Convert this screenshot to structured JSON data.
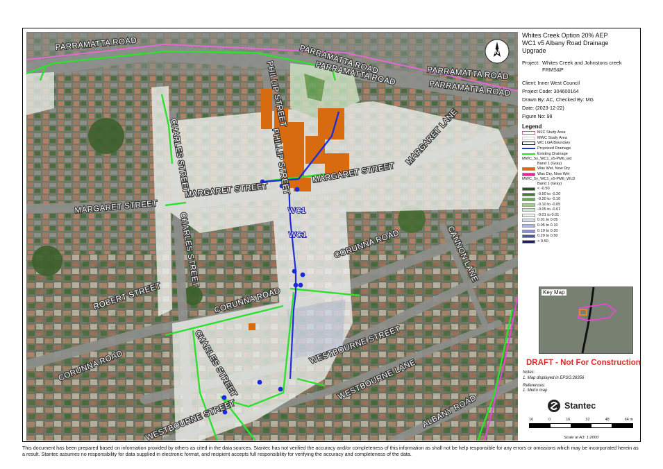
{
  "title": {
    "line1": "Whites Creek Option 20% AEP",
    "line2": "WC1 v5 Albany Road Drainage",
    "line3": "Upgrade"
  },
  "project": {
    "key": "Project:",
    "value": "Whites Creek and Johnstons creek FRMS&P"
  },
  "meta": {
    "client": "Client:  Inner West Council",
    "code": "Project Code:  304600164",
    "drawn": "Drawn By:  AC, Checked By: MG",
    "date": "Date:  (2023-12-22)",
    "figure": "Figure No:  98"
  },
  "north": "N",
  "legend": {
    "title": "Legend",
    "items": [
      {
        "label": "MJC Study Area",
        "kind": "box",
        "color": "#e04bd0"
      },
      {
        "label": "MWC Study Area",
        "kind": "box",
        "color": "#f2b2e8"
      },
      {
        "label": "WC LGA Boundary",
        "kind": "box",
        "color": "#111111"
      },
      {
        "label": "Proposed Drainage",
        "kind": "line",
        "color": "#1d2fd6"
      },
      {
        "label": "Existing Drainage",
        "kind": "line",
        "color": "#2ee02e"
      }
    ],
    "group1": {
      "name": "MWC_5y_WC1_v5-PM6_wd",
      "band": "Band 1 (Gray)"
    },
    "wetdry": [
      {
        "label": "Was Wet, Now Dry",
        "color": "#d86a10"
      },
      {
        "label": "Was Dry, Now Wet",
        "color": "#e0249a"
      }
    ],
    "group2": {
      "name": "MWC_5y_WC1_v5-PM6_WLD",
      "band": "Band 1 (Gray)"
    },
    "classes": [
      {
        "label": "< -0.50",
        "color": "#1f5a1a"
      },
      {
        "label": "-0.50 to -0.20",
        "color": "#3e7f2e"
      },
      {
        "label": "-0.20 to -0.10",
        "color": "#6aa857"
      },
      {
        "label": "-0.10 to -0.05",
        "color": "#9ccb8c"
      },
      {
        "label": "-0.05 to -0.01",
        "color": "#cfe7c6"
      },
      {
        "label": "-0.01 to 0.01",
        "color": "#f2f2f2"
      },
      {
        "label": "0.01 to 0.05",
        "color": "#d6dcee"
      },
      {
        "label": "0.05 to 0.10",
        "color": "#adb7dd"
      },
      {
        "label": "0.10 to 0.20",
        "color": "#8191c8"
      },
      {
        "label": "0.20 to 0.50",
        "color": "#4b56a3"
      },
      {
        "label": "> 0.50",
        "color": "#1d1b6c"
      }
    ]
  },
  "keymap_title": "Key Map",
  "draft": "DRAFT - Not For Construction",
  "notes": {
    "heading": "Notes:",
    "line": "1. Map displayed in EPSG:28356",
    "refs_heading": "References:",
    "ref": "1. Metro map"
  },
  "logo": "Stantec",
  "scale": {
    "ticks": [
      "16",
      "0",
      "16",
      "32",
      "48",
      "64 m"
    ],
    "text": "Scale at A3: 1:2000"
  },
  "disclaimer": "This document has been prepared based on information provided by others as cited in the data sources. Stantec has not verified the accuracy and/or completeness of this information as shall not be help responsible for any errors or omissions which may be incorporated herein as a result. Stantec assumes no responsibility for data supplied in electronic format, and recipient accepts full responsibility for verifying the accuracy and completeness of the data.",
  "map_labels": {
    "parramatta_1": "PARRAMATTA ROAD",
    "parramatta_2": "PARRAMATTA ROAD",
    "parramatta_3": "PARRAMATTA ROAD",
    "parramatta_4": "PARRAMATTA ROAD",
    "parramatta_5": "PARRAMATTA ROAD",
    "phillip_1": "PHILLIP STREET",
    "phillip_2": "PHILLIP STREET",
    "charles_1": "CHARLES STREET",
    "charles_2": "CHARLES STREET",
    "charles_3": "CHARLES STREET",
    "margaret_1": "MARGARET STREET",
    "margaret_2": "MARGARET STREET",
    "margaret_3": "MARGARET STREET",
    "margaret_lane": "MARGARET LANE",
    "cannon_lane": "CANNON LANE",
    "corunna_1": "CORUNNA ROAD",
    "corunna_2": "CORUNNA ROAD",
    "corunna_3": "CORUNNA ROAD",
    "robert": "ROBERT STREET",
    "westbourne_1": "WESTBOURNE STREET",
    "westbourne_2": "WESTBOURNE STREET",
    "westbourne_lane": "WESTBOURNE LANE",
    "albany": "ALBANY ROAD",
    "wc1_a": "WC1",
    "wc1_b": "WC1"
  }
}
